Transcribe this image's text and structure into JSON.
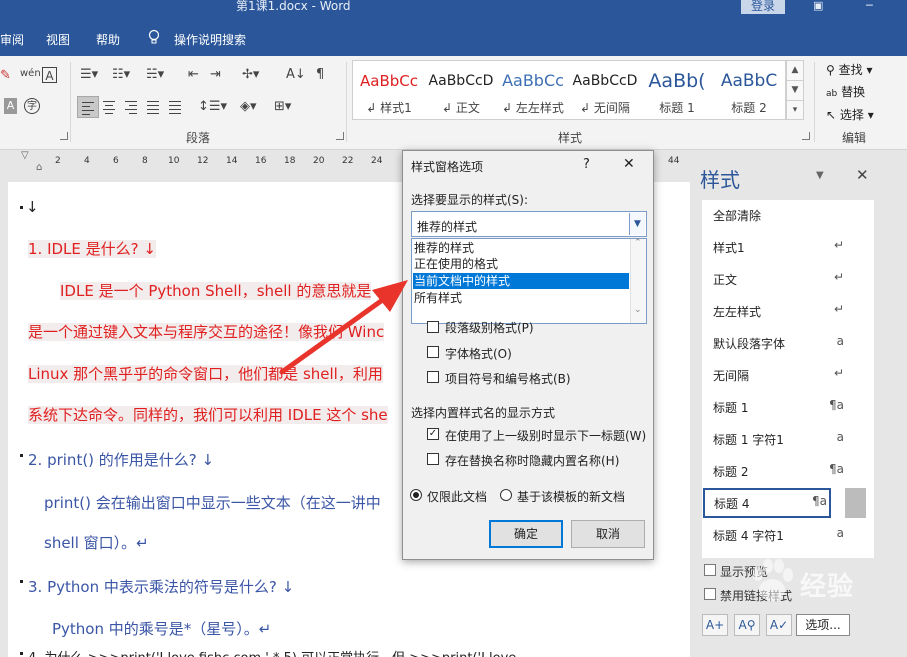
{
  "titlebar": {
    "title": "第1课1.docx  -  Word",
    "login": "登录"
  },
  "menu": {
    "items": [
      "审阅",
      "视图",
      "帮助"
    ],
    "tell_me": "操作说明搜索"
  },
  "ribbon": {
    "paragraph_group": "段落",
    "styles_group": "样式",
    "editing_group": "编辑",
    "gallery": [
      {
        "preview": "AaBbCc",
        "name": "样式1",
        "color": "#e02020"
      },
      {
        "preview": "AaBbCcD",
        "name": "正文",
        "color": "#222222"
      },
      {
        "preview": "AaBbCc",
        "name": "左左样式",
        "color": "#3d6fb5"
      },
      {
        "preview": "AaBbCcD",
        "name": "无间隔",
        "color": "#222222"
      },
      {
        "preview": "AaBb(",
        "name": "标题 1",
        "color": "#2b579a"
      },
      {
        "preview": "AaBbC",
        "name": "标题 2",
        "color": "#2b579a"
      }
    ],
    "find": "查找",
    "replace": "替换",
    "select": "选择"
  },
  "ruler": {
    "ticks": [
      "2",
      "4",
      "6",
      "8",
      "10",
      "12",
      "14",
      "16",
      "18",
      "20",
      "22",
      "24",
      "44"
    ]
  },
  "document": {
    "lines": [
      {
        "text": "↓",
        "color": "black"
      },
      {
        "text": "1. IDLE  是什么? ↓",
        "color": "red"
      },
      {
        "text": "IDLE 是一个 Python Shell，shell 的意思就是",
        "color": "red"
      },
      {
        "text": "是一个通过键入文本与程序交互的途径！像我们 Winc",
        "color": "red"
      },
      {
        "text": "Linux 那个黑乎乎的命令窗口，他们都是 shell，利用",
        "color": "red"
      },
      {
        "text": "系统下达命令。同样的，我们可以利用 IDLE 这个 she",
        "color": "red"
      },
      {
        "text": "2. print()  的作用是什么? ↓",
        "color": "blue"
      },
      {
        "text": "print()  会在输出窗口中显示一些文本（在这一讲中",
        "color": "blue"
      },
      {
        "text": "shell 窗口）。↵",
        "color": "blue"
      },
      {
        "text": "3. Python  中表示乘法的符号是什么? ↓",
        "color": "blue"
      },
      {
        "text": "Python 中的乘号是*（星号）。↵",
        "color": "blue"
      },
      {
        "text": "4.  为什么  >>>print('I love fishc.com ' * 5)  可以正常执行，但  >>>print('I love",
        "color": "black"
      }
    ]
  },
  "dialog": {
    "title": "样式窗格选项",
    "help": "?",
    "close": "✕",
    "select_label": "选择要显示的样式(S):",
    "combo_value": "推荐的样式",
    "options": [
      "推荐的样式",
      "正在使用的格式",
      "当前文档中的样式",
      "所有样式"
    ],
    "selected_option": "当前文档中的样式",
    "format_checks": [
      {
        "label": "段落级别格式(P)",
        "checked": false
      },
      {
        "label": "字体格式(O)",
        "checked": false
      },
      {
        "label": "项目符号和编号格式(B)",
        "checked": false
      }
    ],
    "builtin_label": "选择内置样式名的显示方式",
    "builtin_checks": [
      {
        "label": "在使用了上一级别时显示下一标题(W)",
        "checked": true
      },
      {
        "label": "存在替换名称时隐藏内置名称(H)",
        "checked": false
      }
    ],
    "scope": [
      {
        "label": "仅限此文档",
        "checked": true
      },
      {
        "label": "基于该模板的新文档",
        "checked": false
      }
    ],
    "ok": "确定",
    "cancel": "取消"
  },
  "style_pane": {
    "title": "样式",
    "items": [
      {
        "label": "全部清除",
        "mark": ""
      },
      {
        "label": "样式1",
        "mark": "↵"
      },
      {
        "label": "正文",
        "mark": "↵"
      },
      {
        "label": "左左样式",
        "mark": "↵"
      },
      {
        "label": "默认段落字体",
        "mark": "a"
      },
      {
        "label": "无间隔",
        "mark": "↵"
      },
      {
        "label": "标题 1",
        "mark": "¶a"
      },
      {
        "label": "标题 1 字符1",
        "mark": "a"
      },
      {
        "label": "标题 2",
        "mark": "¶a"
      },
      {
        "label": "标题 4",
        "mark": "¶a"
      },
      {
        "label": "标题 4 字符1",
        "mark": "a"
      }
    ],
    "selected_item": "标题 4",
    "show_preview": "显示预览",
    "disable_linked": "禁用链接样式",
    "options_button": "选项..."
  },
  "watermark": "经验"
}
